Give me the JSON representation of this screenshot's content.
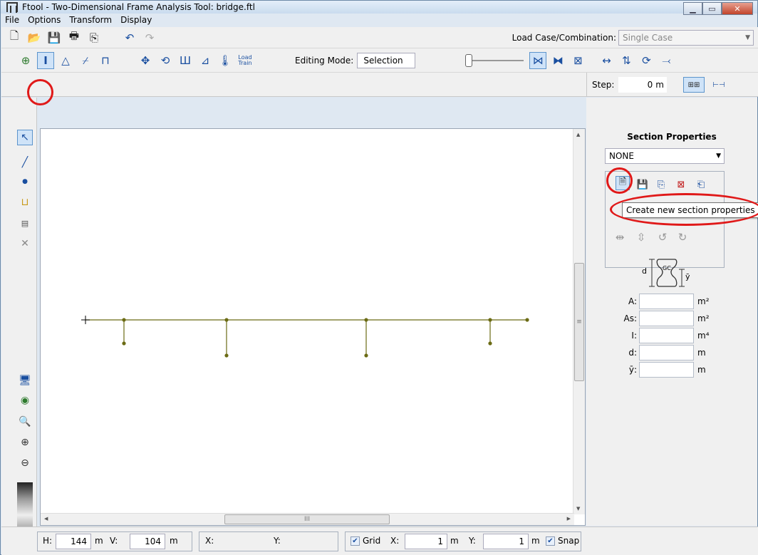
{
  "window": {
    "title": "Ftool - Two-Dimensional Frame Analysis Tool: bridge.ftl"
  },
  "menu": [
    "File",
    "Options",
    "Transform",
    "Display"
  ],
  "toolbar": {
    "load_case_label": "Load Case/Combination:",
    "load_case_value": "Single Case",
    "load_train_label": "Load\nTrain",
    "editing_mode_label": "Editing Mode:",
    "editing_mode_value": "Selection"
  },
  "step": {
    "label": "Step:",
    "value": "0",
    "unit": "m"
  },
  "section_panel": {
    "title": "Section Properties",
    "selected": "NONE",
    "tooltip": "Create new section properties",
    "diagram_labels": {
      "d": "d",
      "gc": "GC",
      "ybar": "ȳ"
    },
    "properties": [
      {
        "label": "A:",
        "unit": "m²"
      },
      {
        "label": "As:",
        "unit": "m²"
      },
      {
        "label": "I:",
        "unit": "m⁴"
      },
      {
        "label": "d:",
        "unit": "m"
      },
      {
        "label": "ȳ:",
        "unit": "m"
      }
    ]
  },
  "status": {
    "h_label": "H:",
    "h_value": "144",
    "h_unit": "m",
    "v_label": "V:",
    "v_value": "104",
    "v_unit": "m",
    "x_label": "X:",
    "y_label": "Y:",
    "grid_label": "Grid",
    "grid_x_label": "X:",
    "grid_x_value": "1",
    "grid_x_unit": "m",
    "grid_y_label": "Y:",
    "grid_y_value": "1",
    "grid_y_unit": "m",
    "snap_label": "Snap"
  },
  "scroll": {
    "hscroll_mark": "III",
    "vscroll_mark": "≡"
  },
  "colors": {
    "frame": "#6b6b14",
    "highlight": "#e01919"
  }
}
